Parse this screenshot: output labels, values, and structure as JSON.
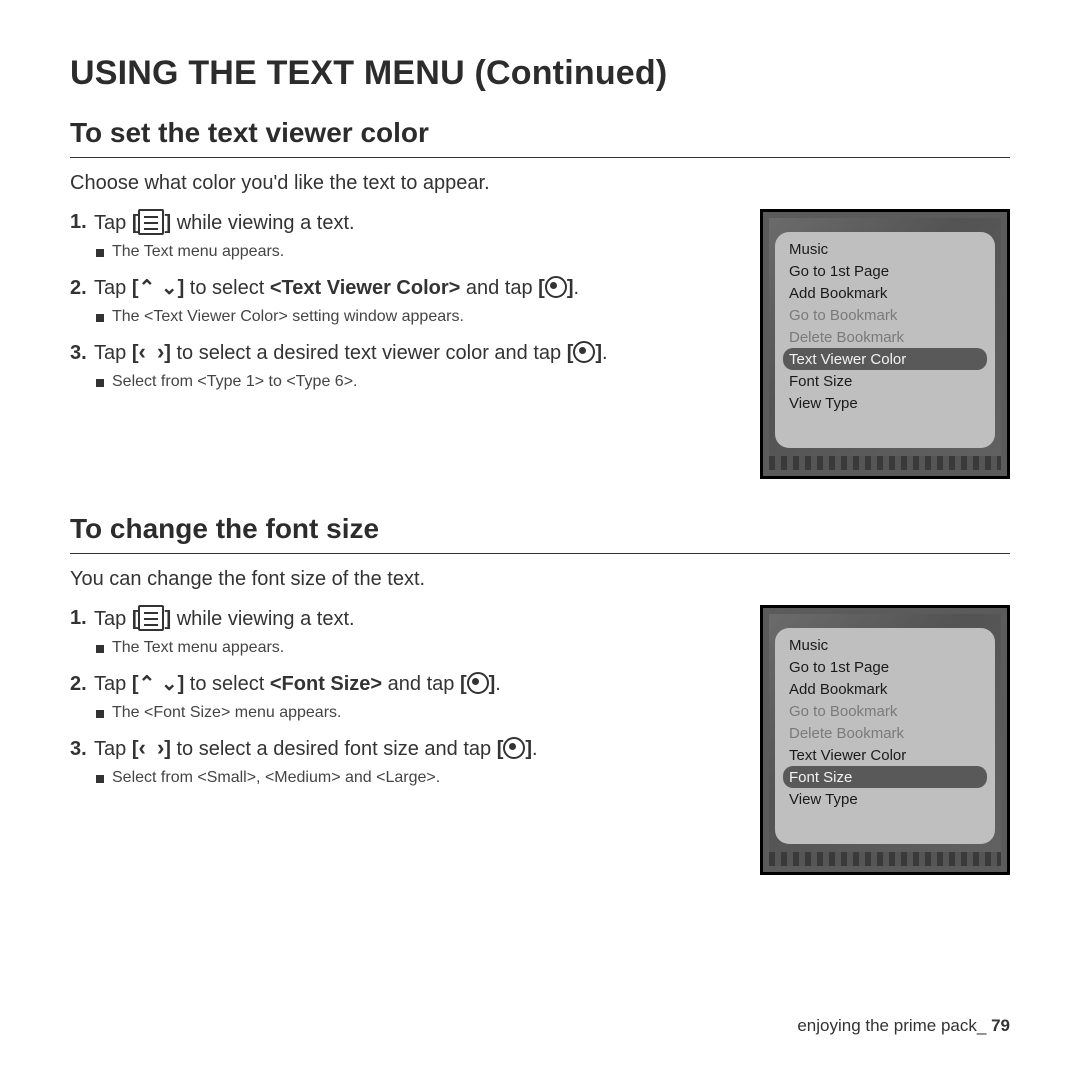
{
  "title": "USING THE TEXT MENU (Continued)",
  "section1": {
    "heading": "To set the text viewer color",
    "intro": "Choose what color you'd like the text to appear.",
    "steps": {
      "s1": {
        "num": "1.",
        "pre": "Tap ",
        "post": " while viewing a text.",
        "sub": "The Text menu appears."
      },
      "s2": {
        "num": "2.",
        "pre": "Tap ",
        "mid1": " to select ",
        "bold1": "<Text Viewer Color>",
        "mid2": " and tap ",
        "post": ".",
        "sub": "The <Text Viewer Color> setting window appears."
      },
      "s3": {
        "num": "3.",
        "pre": "Tap ",
        "mid1": " to select a desired text viewer color and tap ",
        "post": ".",
        "sub": "Select from <Type 1> to <Type 6>."
      }
    }
  },
  "section2": {
    "heading": "To change the font size",
    "intro": "You can change the font size of the text.",
    "steps": {
      "s1": {
        "num": "1.",
        "pre": "Tap ",
        "post": " while viewing a text.",
        "sub": "The Text menu appears."
      },
      "s2": {
        "num": "2.",
        "pre": "Tap ",
        "mid1": " to select ",
        "bold1": "<Font Size>",
        "mid2": " and tap ",
        "post": ".",
        "sub": "The <Font Size> menu appears."
      },
      "s3": {
        "num": "3.",
        "pre": "Tap ",
        "mid1": " to select a desired font size and tap ",
        "post": ".",
        "sub": "Select from <Small>, <Medium> and <Large>."
      }
    }
  },
  "device_menu": {
    "items": [
      {
        "label": "Music",
        "dim": false
      },
      {
        "label": "Go to 1st Page",
        "dim": false
      },
      {
        "label": "Add Bookmark",
        "dim": false
      },
      {
        "label": "Go to Bookmark",
        "dim": true
      },
      {
        "label": "Delete Bookmark",
        "dim": true
      },
      {
        "label": "Text Viewer Color",
        "dim": false
      },
      {
        "label": "Font Size",
        "dim": false
      },
      {
        "label": "View Type",
        "dim": false
      }
    ],
    "selected1": "Text Viewer Color",
    "selected2": "Font Size"
  },
  "icons": {
    "updown_left": "⌃",
    "updown_right": "⌄",
    "leftright_left": "‹",
    "leftright_right": "›",
    "bracket_l": "[",
    "bracket_r": "]"
  },
  "footer": {
    "text": "enjoying the prime pack_",
    "page": "79"
  }
}
